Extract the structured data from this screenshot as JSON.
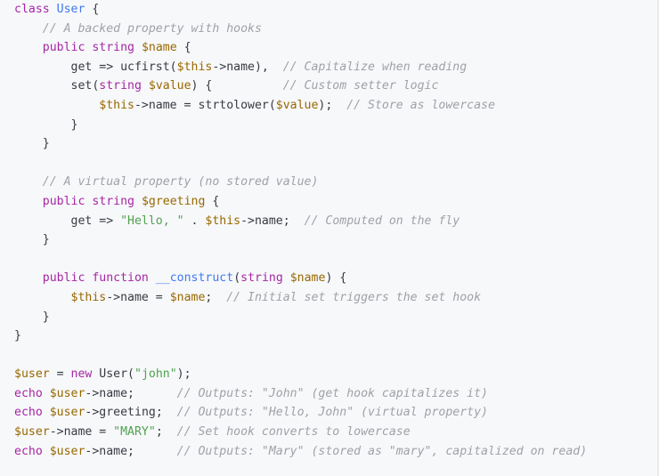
{
  "colors": {
    "background": "#f7f8fa",
    "keyword": "#a626a4",
    "class_name": "#4078f2",
    "variable": "#986801",
    "function": "#4078f2",
    "string": "#50a14f",
    "comment": "#a0a1a7",
    "plain": "#383a42"
  },
  "lines": [
    [
      {
        "c": "kw",
        "t": "class"
      },
      {
        "c": "pl",
        "t": " "
      },
      {
        "c": "cls",
        "t": "User"
      },
      {
        "c": "pl",
        "t": " {"
      }
    ],
    [
      {
        "c": "pl",
        "t": "    "
      },
      {
        "c": "cm",
        "t": "// A backed property with hooks"
      }
    ],
    [
      {
        "c": "pl",
        "t": "    "
      },
      {
        "c": "kw",
        "t": "public"
      },
      {
        "c": "pl",
        "t": " "
      },
      {
        "c": "kw",
        "t": "string"
      },
      {
        "c": "pl",
        "t": " "
      },
      {
        "c": "var",
        "t": "$name"
      },
      {
        "c": "pl",
        "t": " {"
      }
    ],
    [
      {
        "c": "pl",
        "t": "        get => ucfirst("
      },
      {
        "c": "var",
        "t": "$this"
      },
      {
        "c": "pl",
        "t": "->name),  "
      },
      {
        "c": "cm",
        "t": "// Capitalize when reading"
      }
    ],
    [
      {
        "c": "pl",
        "t": "        set("
      },
      {
        "c": "kw",
        "t": "string"
      },
      {
        "c": "pl",
        "t": " "
      },
      {
        "c": "var",
        "t": "$value"
      },
      {
        "c": "pl",
        "t": ") {          "
      },
      {
        "c": "cm",
        "t": "// Custom setter logic"
      }
    ],
    [
      {
        "c": "pl",
        "t": "            "
      },
      {
        "c": "var",
        "t": "$this"
      },
      {
        "c": "pl",
        "t": "->name = strtolower("
      },
      {
        "c": "var",
        "t": "$value"
      },
      {
        "c": "pl",
        "t": ");  "
      },
      {
        "c": "cm",
        "t": "// Store as lowercase"
      }
    ],
    [
      {
        "c": "pl",
        "t": "        }"
      }
    ],
    [
      {
        "c": "pl",
        "t": "    }"
      }
    ],
    [],
    [
      {
        "c": "pl",
        "t": "    "
      },
      {
        "c": "cm",
        "t": "// A virtual property (no stored value)"
      }
    ],
    [
      {
        "c": "pl",
        "t": "    "
      },
      {
        "c": "kw",
        "t": "public"
      },
      {
        "c": "pl",
        "t": " "
      },
      {
        "c": "kw",
        "t": "string"
      },
      {
        "c": "pl",
        "t": " "
      },
      {
        "c": "var",
        "t": "$greeting"
      },
      {
        "c": "pl",
        "t": " {"
      }
    ],
    [
      {
        "c": "pl",
        "t": "        get => "
      },
      {
        "c": "str",
        "t": "\"Hello, \""
      },
      {
        "c": "pl",
        "t": " . "
      },
      {
        "c": "var",
        "t": "$this"
      },
      {
        "c": "pl",
        "t": "->name;  "
      },
      {
        "c": "cm",
        "t": "// Computed on the fly"
      }
    ],
    [
      {
        "c": "pl",
        "t": "    }"
      }
    ],
    [],
    [
      {
        "c": "pl",
        "t": "    "
      },
      {
        "c": "kw",
        "t": "public"
      },
      {
        "c": "pl",
        "t": " "
      },
      {
        "c": "kw",
        "t": "function"
      },
      {
        "c": "pl",
        "t": " "
      },
      {
        "c": "fn",
        "t": "__construct"
      },
      {
        "c": "pl",
        "t": "("
      },
      {
        "c": "kw",
        "t": "string"
      },
      {
        "c": "pl",
        "t": " "
      },
      {
        "c": "var",
        "t": "$name"
      },
      {
        "c": "pl",
        "t": ") {"
      }
    ],
    [
      {
        "c": "pl",
        "t": "        "
      },
      {
        "c": "var",
        "t": "$this"
      },
      {
        "c": "pl",
        "t": "->name = "
      },
      {
        "c": "var",
        "t": "$name"
      },
      {
        "c": "pl",
        "t": ";  "
      },
      {
        "c": "cm",
        "t": "// Initial set triggers the set hook"
      }
    ],
    [
      {
        "c": "pl",
        "t": "    }"
      }
    ],
    [
      {
        "c": "pl",
        "t": "}"
      }
    ],
    [],
    [
      {
        "c": "var",
        "t": "$user"
      },
      {
        "c": "pl",
        "t": " = "
      },
      {
        "c": "kw",
        "t": "new"
      },
      {
        "c": "pl",
        "t": " User("
      },
      {
        "c": "str",
        "t": "\"john\""
      },
      {
        "c": "pl",
        "t": ");"
      }
    ],
    [
      {
        "c": "kw",
        "t": "echo"
      },
      {
        "c": "pl",
        "t": " "
      },
      {
        "c": "var",
        "t": "$user"
      },
      {
        "c": "pl",
        "t": "->name;      "
      },
      {
        "c": "cm",
        "t": "// Outputs: \"John\" (get hook capitalizes it)"
      }
    ],
    [
      {
        "c": "kw",
        "t": "echo"
      },
      {
        "c": "pl",
        "t": " "
      },
      {
        "c": "var",
        "t": "$user"
      },
      {
        "c": "pl",
        "t": "->greeting;  "
      },
      {
        "c": "cm",
        "t": "// Outputs: \"Hello, John\" (virtual property)"
      }
    ],
    [
      {
        "c": "var",
        "t": "$user"
      },
      {
        "c": "pl",
        "t": "->name = "
      },
      {
        "c": "str",
        "t": "\"MARY\""
      },
      {
        "c": "pl",
        "t": ";  "
      },
      {
        "c": "cm",
        "t": "// Set hook converts to lowercase"
      }
    ],
    [
      {
        "c": "kw",
        "t": "echo"
      },
      {
        "c": "pl",
        "t": " "
      },
      {
        "c": "var",
        "t": "$user"
      },
      {
        "c": "pl",
        "t": "->name;      "
      },
      {
        "c": "cm",
        "t": "// Outputs: \"Mary\" (stored as \"mary\", capitalized on read)"
      }
    ]
  ]
}
